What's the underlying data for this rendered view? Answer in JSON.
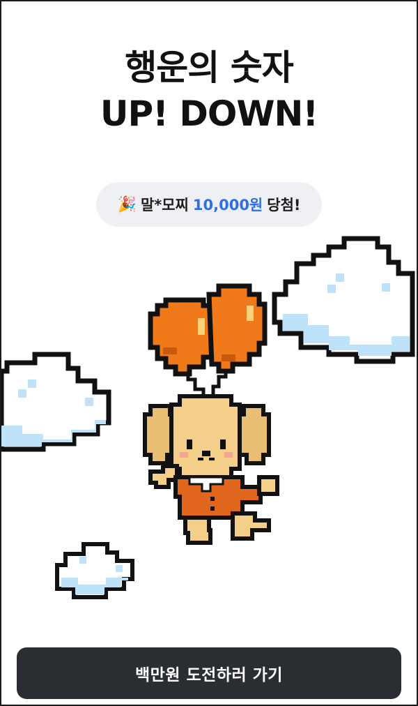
{
  "title": {
    "line1": "행운의 숫자",
    "line2": "UP! DOWN!"
  },
  "winner": {
    "icon": "party-popper-icon",
    "name": "말*모찌",
    "amount": "10,000원",
    "suffix": "당첨!",
    "amount_color": "#2f6fe4"
  },
  "cta": {
    "label": "백만원 도전하러 가기"
  },
  "colors": {
    "balloon": "#f07a1a",
    "dog": "#f3cf8a",
    "shirt": "#e0661e",
    "cloud": "#e8f5ff",
    "button": "#2a2e33"
  }
}
